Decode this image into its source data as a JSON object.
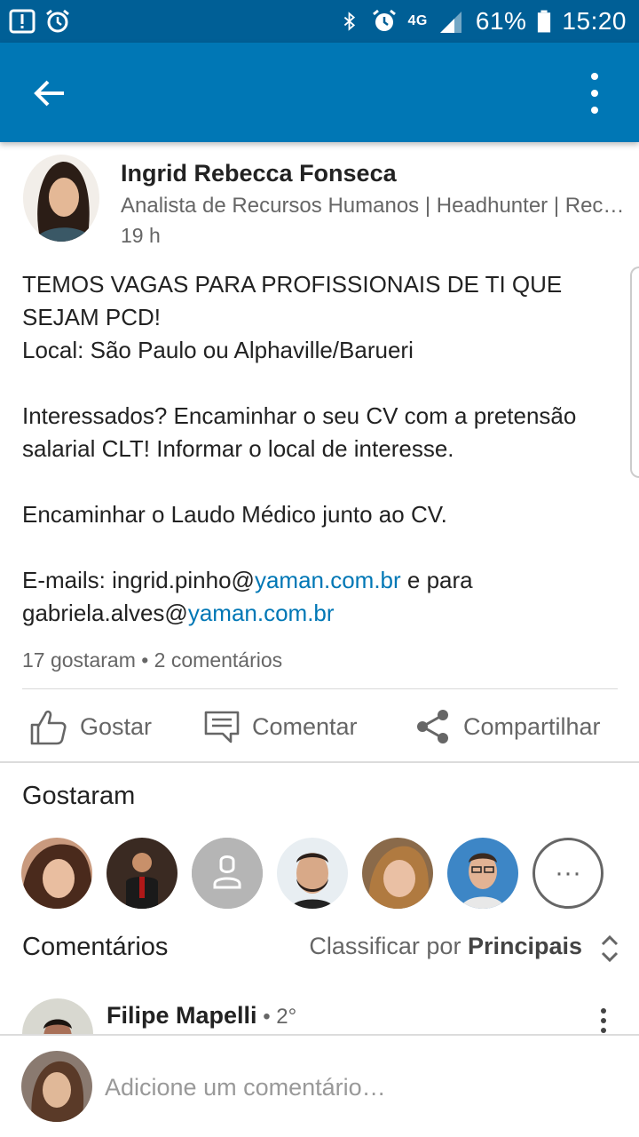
{
  "status_bar": {
    "battery": "61%",
    "time": "15:20",
    "network": "4G"
  },
  "post": {
    "author_name": "Ingrid Rebecca Fonseca",
    "author_headline": "Analista de Recursos Humanos | Headhunter | Recr…",
    "time": "19 h",
    "lines": {
      "l1": "TEMOS VAGAS PARA PROFISSIONAIS DE TI QUE SEJAM PCD!",
      "l2": "Local: São Paulo ou Alphaville/Barueri",
      "l3": "Interessados? Encaminhar o seu CV com a pretensão salarial CLT! Informar o local de interesse.",
      "l4": "Encaminhar o Laudo Médico junto ao CV.",
      "email_prefix": "E-mails: ingrid.pinho@",
      "email_domain_1": "yaman.com.br",
      "email_middle": " e para",
      "email2_user": "gabriela.alves@",
      "email_domain_2": "yaman.com.br"
    },
    "social_counts": "17 gostaram • 2 comentários"
  },
  "actions": {
    "like": "Gostar",
    "comment": "Comentar",
    "share": "Compartilhar"
  },
  "likes_section": {
    "title": "Gostaram",
    "more_label": "···"
  },
  "comments_section": {
    "title": "Comentários",
    "sort_prefix": "Classificar por ",
    "sort_value": "Principais",
    "first_comment": {
      "author": "Filipe Mapelli",
      "degree": " • 2°"
    }
  },
  "composer": {
    "placeholder": "Adicione um comentário…"
  },
  "colors": {
    "status_bar": "#005f96",
    "app_bar": "#0077b5",
    "link": "#0077b5"
  }
}
